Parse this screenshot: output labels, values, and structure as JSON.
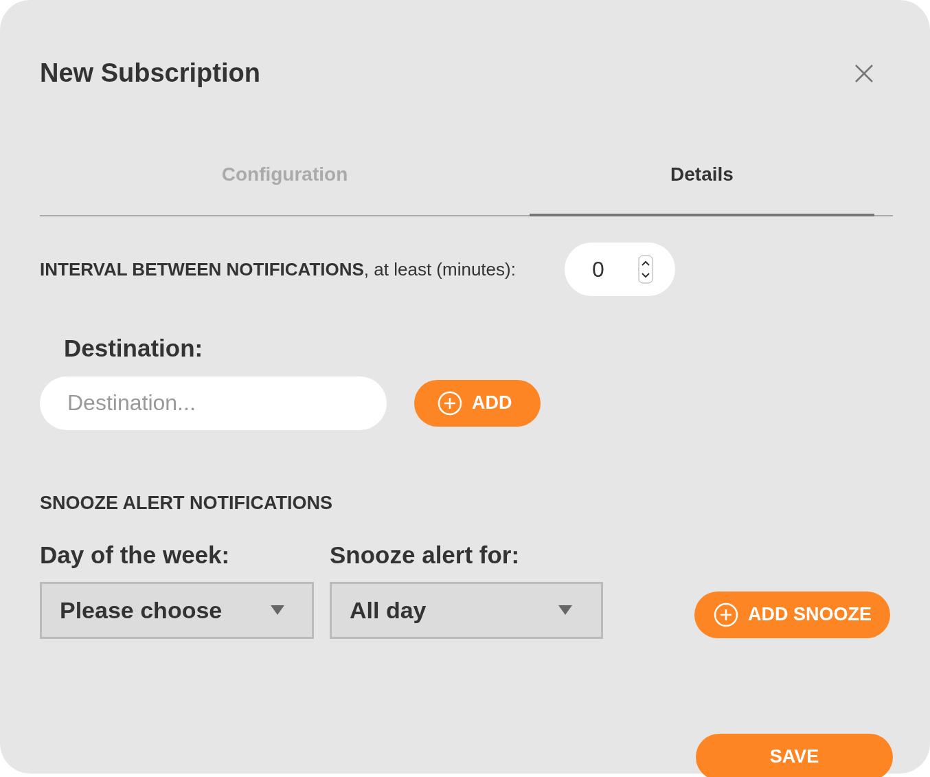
{
  "dialog": {
    "title": "New Subscription"
  },
  "tabs": [
    {
      "label": "Configuration",
      "selected": false
    },
    {
      "label": "Details",
      "selected": true
    }
  ],
  "interval": {
    "label": "**INTERVAL BETWEEN NOTIFICATIONS**, at least (minutes):",
    "value": "0"
  },
  "destination": {
    "label": "Destination:",
    "placeholder": "Destination...",
    "add_button": "ADD"
  },
  "snooze": {
    "heading": "SNOOZE ALERT NOTIFICATIONS",
    "day_label": "Day of the week:",
    "day_value": "Please choose",
    "duration_label": "Snooze alert for:",
    "duration_value": "All day",
    "add_button": "ADD SNOOZE"
  },
  "save_button": "SAVE"
}
